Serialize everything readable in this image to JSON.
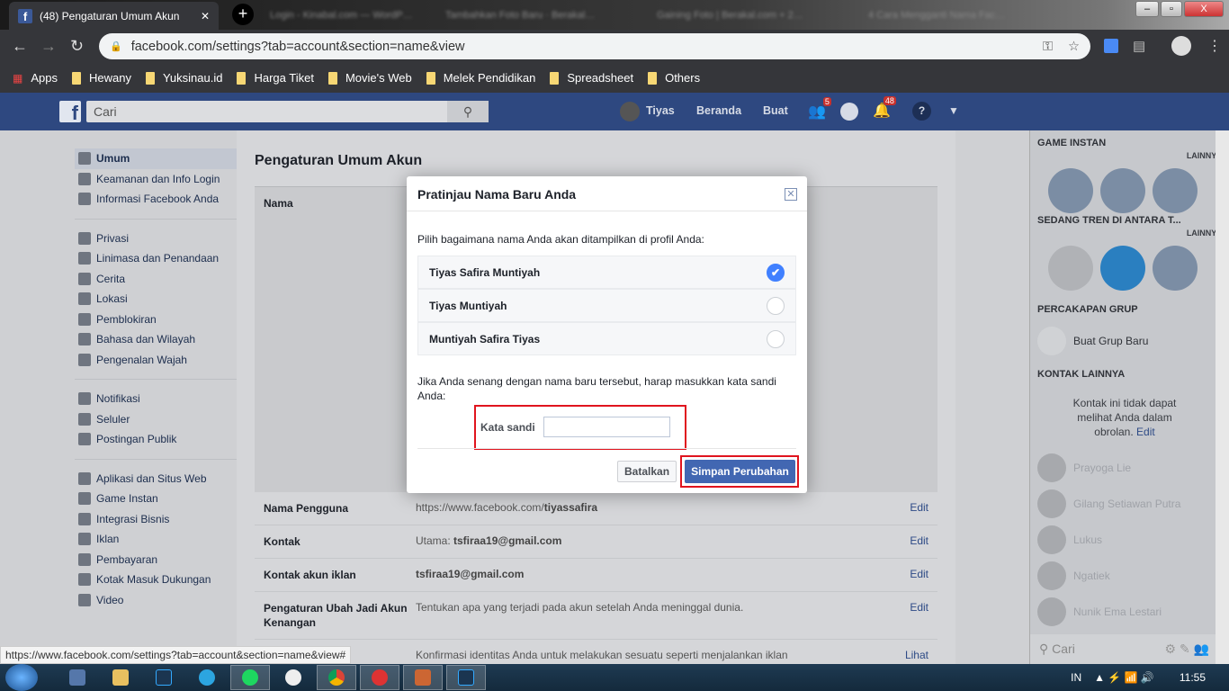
{
  "browser": {
    "active_tab": "(48) Pengaturan Umum Akun",
    "other_tabs": [
      "Login - Kinabal.com — WordP…",
      "Tambahkan Foto Baru · Berakal…",
      "Gaining Foto | Berakal.com + 2…",
      "4 Cara Mengganti Nama Fac…"
    ],
    "url": "facebook.com/settings?tab=account&section=name&view",
    "bookmarks": [
      "Apps",
      "Hewany",
      "Yuksinau.id",
      "Harga Tiket",
      "Movie's Web",
      "Melek Pendidikan",
      "Spreadsheet",
      "Others"
    ],
    "status_url": "https://www.facebook.com/settings?tab=account&section=name&view#"
  },
  "fb_header": {
    "search_placeholder": "Cari",
    "user": "Tiyas",
    "home": "Beranda",
    "create": "Buat",
    "friend_requests": "5",
    "notifications": "48",
    "brand_color": "#4267b2"
  },
  "left_nav": [
    [
      "Umum",
      "Keamanan dan Info Login",
      "Informasi Facebook Anda"
    ],
    [
      "Privasi",
      "Linimasa dan Penandaan",
      "Cerita",
      "Lokasi",
      "Pemblokiran",
      "Bahasa dan Wilayah",
      "Pengenalan Wajah"
    ],
    [
      "Notifikasi",
      "Seluler",
      "Postingan Publik"
    ],
    [
      "Aplikasi dan Situs Web",
      "Game Instan",
      "Integrasi Bisnis",
      "Iklan",
      "Pembayaran",
      "Kotak Masuk Dukungan",
      "Video"
    ]
  ],
  "settings": {
    "title": "Pengaturan Umum Akun",
    "name_label": "Nama",
    "rows": [
      {
        "label": "Nama Pengguna",
        "prefix": "https://www.facebook.com/",
        "value": "tiyassafira",
        "action": "Edit"
      },
      {
        "label": "Kontak",
        "prefix": "Utama: ",
        "value": "tsfiraa19@gmail.com",
        "action": "Edit"
      },
      {
        "label": "Kontak akun iklan",
        "prefix": "",
        "value": "tsfiraa19@gmail.com",
        "action": "Edit"
      },
      {
        "label": "Pengaturan Ubah Jadi Akun Kenangan",
        "prefix": "Tentukan apa yang terjadi pada akun setelah Anda meninggal dunia.",
        "value": "",
        "action": "Edit"
      },
      {
        "label": "…as",
        "prefix": "Konfirmasi identitas Anda untuk melakukan sesuatu seperti menjalankan iklan",
        "value": "",
        "action": "Lihat"
      }
    ]
  },
  "modal": {
    "title": "Pratinjau Nama Baru Anda",
    "intro": "Pilih bagaimana nama Anda akan ditampilkan di profil Anda:",
    "options": [
      {
        "label": "Tiyas Safira Muntiyah",
        "selected": true
      },
      {
        "label": "Tiyas Muntiyah",
        "selected": false
      },
      {
        "label": "Muntiyah Safira Tiyas",
        "selected": false
      }
    ],
    "note": "Jika Anda senang dengan nama baru tersebut, harap masukkan kata sandi Anda:",
    "password_label": "Kata sandi",
    "password_value": "",
    "cancel": "Batalkan",
    "save": "Simpan Perubahan",
    "highlight_color": "#e0141e"
  },
  "right_sidebar": {
    "games": "GAME INSTAN",
    "more": "LAINNYA",
    "trending": "SEDANG TREN DI ANTARA T...",
    "group_chat": "PERCAKAPAN GRUP",
    "new_group": "Buat Grup Baru",
    "other_contacts": "KONTAK LAINNYA",
    "contacts_note": "Kontak ini tidak dapat melihat Anda dalam obrolan.",
    "edit": "Edit",
    "contacts": [
      "Prayoga Lie",
      "Gilang Setiawan Putra",
      "Lukus",
      "Ngatiek",
      "Nunik Ema Lestari"
    ],
    "search_placeholder": "Cari"
  },
  "taskbar": {
    "lang": "IN",
    "time": "11:55"
  }
}
